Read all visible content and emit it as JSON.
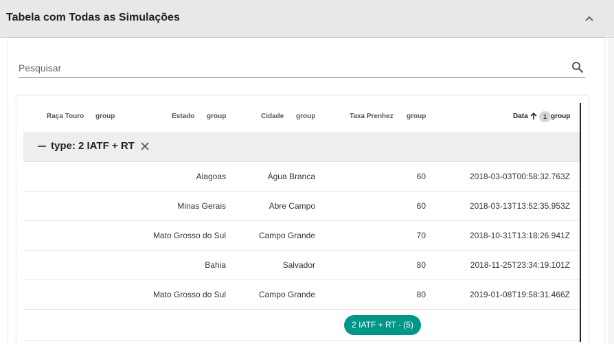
{
  "panel": {
    "title": "Tabela com Todas as Simulações"
  },
  "search": {
    "placeholder": "Pesquisar"
  },
  "columns": [
    {
      "label": "Raça Touro",
      "group": "group"
    },
    {
      "label": "Estado",
      "group": "group"
    },
    {
      "label": "Cidade",
      "group": "group"
    },
    {
      "label": "Taxa Prenhez",
      "group": "group"
    },
    {
      "label": "Data",
      "group": "group",
      "sort_order": "1",
      "sort_direction": "ascending"
    }
  ],
  "group": {
    "label": "type: 2 IATF + RT"
  },
  "rows": [
    {
      "estado": "Alagoas",
      "cidade": "Água Branca",
      "taxa": "60",
      "data": "2018-03-03T00:58:32.763Z"
    },
    {
      "estado": "Minas Gerais",
      "cidade": "Abre Campo",
      "taxa": "60",
      "data": "2018-03-13T13:52:35.953Z"
    },
    {
      "estado": "Mato Grosso do Sul",
      "cidade": "Campo Grande",
      "taxa": "70",
      "data": "2018-10-31T13:18:26.941Z"
    },
    {
      "estado": "Bahia",
      "cidade": "Salvador",
      "taxa": "80",
      "data": "2018-11-25T23:34:19.101Z"
    },
    {
      "estado": "Mato Grosso do Sul",
      "cidade": "Campo Grande",
      "taxa": "80",
      "data": "2019-01-08T19:58:31.466Z"
    }
  ],
  "summary_chip": "2 IATF + RT - (5)",
  "colors": {
    "accent": "#009688",
    "header_bg": "#e8e8e8",
    "group_bg": "#eeeeee"
  },
  "icons": {
    "collapse": "chevron-up-icon",
    "search": "search-icon",
    "sort": "arrow-up-icon",
    "collapse_group": "minus-icon",
    "remove_group": "close-icon"
  }
}
